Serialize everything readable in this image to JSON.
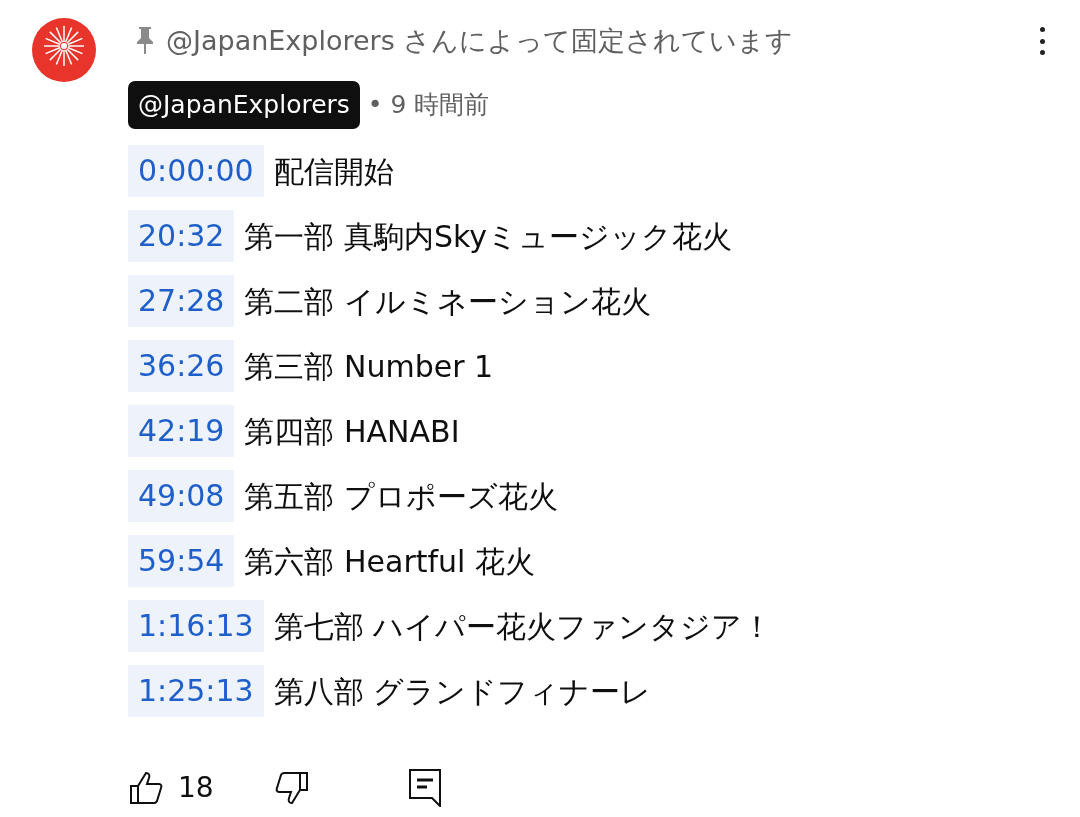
{
  "comment": {
    "pinned_by": "@JapanExplorers さんによって固定されています",
    "author": "@JapanExplorers",
    "age": "• 9 時間前",
    "chapters": [
      {
        "time": "0:00:00",
        "title": "配信開始"
      },
      {
        "time": "20:32",
        "title": "第一部 真駒内Skyミュージック花火"
      },
      {
        "time": "27:28",
        "title": "第二部 イルミネーション花火"
      },
      {
        "time": "36:26",
        "title": "第三部 Number 1"
      },
      {
        "time": "42:19",
        "title": "第四部 HANABI"
      },
      {
        "time": "49:08",
        "title": "第五部 プロポーズ花火"
      },
      {
        "time": "59:54",
        "title": "第六部 Heartful 花火"
      },
      {
        "time": "1:16:13",
        "title": "第七部 ハイパー花火ファンタジア！"
      },
      {
        "time": "1:25:13",
        "title": "第八部 グランドフィナーレ"
      }
    ],
    "likes": "18"
  }
}
